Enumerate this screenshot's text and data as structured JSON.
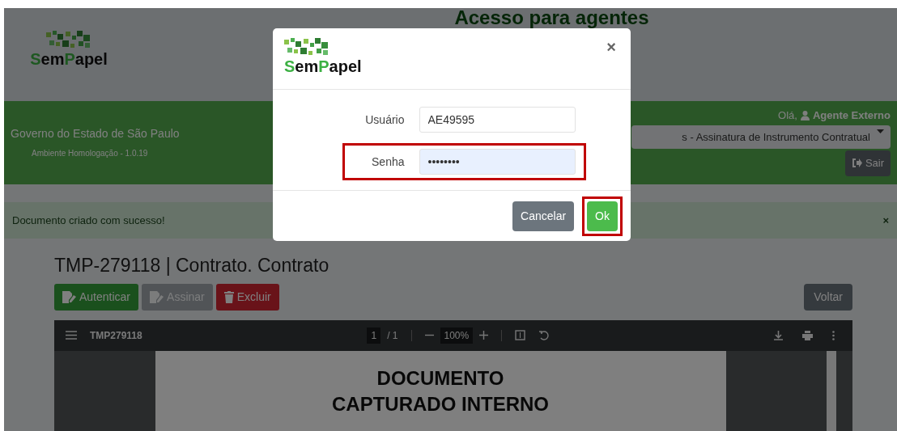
{
  "header": {
    "logo_parts": [
      "Sem",
      "Papel"
    ],
    "title": "Acesso para agentes"
  },
  "banner": {
    "org": "Governo do Estado de São Paulo",
    "environment": "Ambiente Homologação - 1.0.19",
    "greeting": "Olá,",
    "user": "Agente Externo",
    "profile_select": "s - Assinatura de Instrumento Contratual",
    "logout": "Sair"
  },
  "alert": {
    "message": "Documento criado com sucesso!",
    "close": "×"
  },
  "document": {
    "title": "TMP-279118 | Contrato. Contrato",
    "actions": [
      {
        "label": "Autenticar",
        "kind": "success",
        "disabled": false
      },
      {
        "label": "Assinar",
        "kind": "secondary",
        "disabled": true
      },
      {
        "label": "Excluir",
        "kind": "danger",
        "disabled": false
      }
    ],
    "back": "Voltar"
  },
  "pdf_viewer": {
    "file": "TMP279118",
    "page": "1",
    "pages": "/ 1",
    "zoom": "100%",
    "content": [
      "DOCUMENTO",
      "CAPTURADO INTERNO"
    ]
  },
  "modal": {
    "logo_parts": [
      "Sem",
      "Papel"
    ],
    "close": "×",
    "fields": [
      {
        "label": "Usuário",
        "value": "AE49595",
        "kind": "text",
        "highlighted": false
      },
      {
        "label": "Senha",
        "value": "••••••••",
        "kind": "password",
        "highlighted": true
      }
    ],
    "buttons": [
      {
        "label": "Cancelar",
        "kind": "secondary",
        "highlighted": false
      },
      {
        "label": "Ok",
        "kind": "success",
        "highlighted": true
      }
    ]
  }
}
